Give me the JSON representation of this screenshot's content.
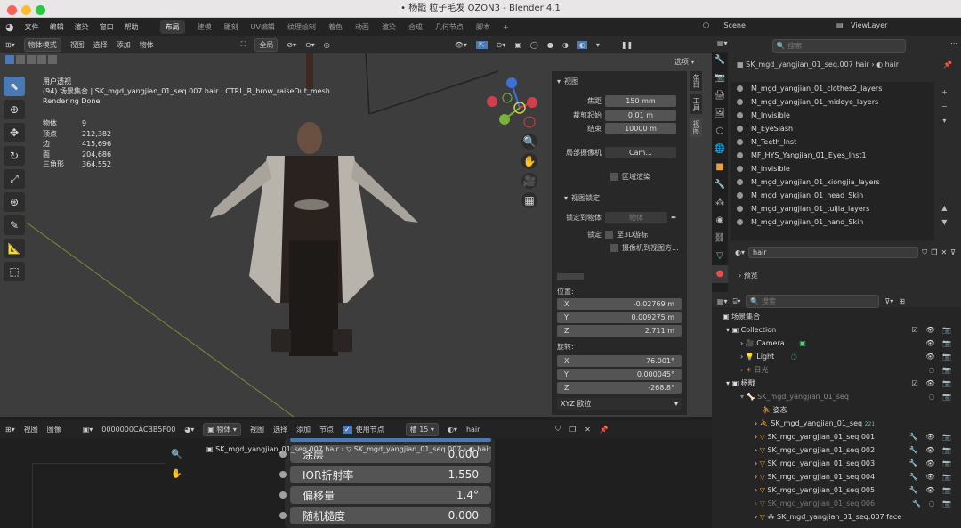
{
  "window": {
    "title": "• 杨戬 粒子毛发 OZON3 - Blender 4.1"
  },
  "menu": {
    "items": [
      "文件",
      "编辑",
      "渲染",
      "窗口",
      "帮助"
    ],
    "workspaces": [
      "布局",
      "建模",
      "雕刻",
      "UV编辑",
      "纹理绘制",
      "着色",
      "动画",
      "渲染",
      "合成",
      "几何节点",
      "脚本"
    ],
    "scene": "Scene",
    "viewlayer": "ViewLayer"
  },
  "viewport": {
    "mode": "物体模式",
    "menus": [
      "视图",
      "选择",
      "添加",
      "物体"
    ],
    "orientation": "全局",
    "options_label": "选项",
    "overlay_title": "用户透视",
    "overlay_path": "(94) 场景集合 | SK_mgd_yangjian_01_seq.007 hair : CTRL_R_brow_raiseOut_mesh",
    "render_status": "Rendering Done",
    "stats": [
      [
        "物体",
        "9"
      ],
      [
        "顶点",
        "212,382"
      ],
      [
        "边",
        "415,696"
      ],
      [
        "面",
        "204,686"
      ],
      [
        "三角形",
        "364,552"
      ]
    ]
  },
  "npanel": {
    "section_view": "视图",
    "focal_label": "焦距",
    "focal": "150 mm",
    "clip_start_label": "裁剪起始",
    "clip_start": "0.01 m",
    "clip_end_label": "结束",
    "clip_end": "10000 m",
    "local_camera_label": "局部摄像机",
    "local_camera": "Cam...",
    "region_render": "区域渲染",
    "section_lock": "视图锁定",
    "lock_obj_label": "锁定到物体",
    "lock_obj_placeholder": "物体",
    "lock_label": "锁定",
    "to_3d_cursor": "至3D游标",
    "cam_to_view": "摄像机到视图方...",
    "loc_label": "位置:",
    "loc": [
      [
        "X",
        "-0.02769 m"
      ],
      [
        "Y",
        "0.009275 m"
      ],
      [
        "Z",
        "2.711 m"
      ]
    ],
    "rot_label": "旋转:",
    "rot": [
      [
        "X",
        "76.001°"
      ],
      [
        "Y",
        "0.000045°"
      ],
      [
        "Z",
        "-268.8°"
      ]
    ],
    "rot_mode": "XYZ 欧拉",
    "tabs": [
      "条目",
      "工具",
      "视图"
    ]
  },
  "props": {
    "object_path": "SK_mgd_yangjian_01_seq.007 hair",
    "mesh": "hair",
    "materials": [
      "M_mgd_yangjian_01_clothes2_layers",
      "M_mgd_yangjian_01_mideye_layers",
      "M_Invisible",
      "M_EyeSlash",
      "M_Teeth_Inst",
      "MF_HYS_Yangjian_01_Eyes_Inst1",
      "M_invisible",
      "M_mgd_yangjian_01_xiongjia_layers",
      "M_mgd_yangjian_01_head_Skin",
      "M_mgd_yangjian_01_tuijia_layers",
      "M_mgd_yangjian_01_hand_Skin"
    ],
    "mat_name": "hair",
    "preview": "预览",
    "search_placeholder": "搜索"
  },
  "outliner": {
    "search_placeholder": "搜索",
    "rows": [
      "场景集合",
      "Collection",
      "Camera",
      "Light",
      "日光",
      "杨戬",
      "SK_mgd_yangjian_01_seq",
      "姿态",
      "SK_mgd_yangjian_01_seq",
      "SK_mgd_yangjian_01_seq.001",
      "SK_mgd_yangjian_01_seq.002",
      "SK_mgd_yangjian_01_seq.003",
      "SK_mgd_yangjian_01_seq.004",
      "SK_mgd_yangjian_01_seq.005",
      "SK_mgd_yangjian_01_seq.006",
      "SK_mgd_yangjian_01_seq.007 face"
    ],
    "badge": "221"
  },
  "bottom": {
    "menus": [
      "视图",
      "图像"
    ],
    "image_id": "0000000CACBB5F00",
    "mode": "物体",
    "menus2": [
      "视图",
      "选择",
      "添加",
      "节点"
    ],
    "use_nodes": "使用节点",
    "slot": "槽 15",
    "mat": "hair",
    "breadcrumb_obj": "SK_mgd_yangjian_01_seq.007 hair",
    "breadcrumb_mesh": "SK_mgd_yangjian_01_seq.007",
    "breadcrumb_mat": "hair",
    "node_rows": [
      [
        "涂层",
        "0.000"
      ],
      [
        "IOR折射率",
        "1.550"
      ],
      [
        "偏移量",
        "1.4°"
      ],
      [
        "随机糙度",
        "0.000"
      ]
    ]
  },
  "colors": {
    "accent": "#4a7ab5",
    "x_axis": "#d0404a",
    "y_axis": "#7ab33a",
    "z_axis": "#3b72d8"
  }
}
